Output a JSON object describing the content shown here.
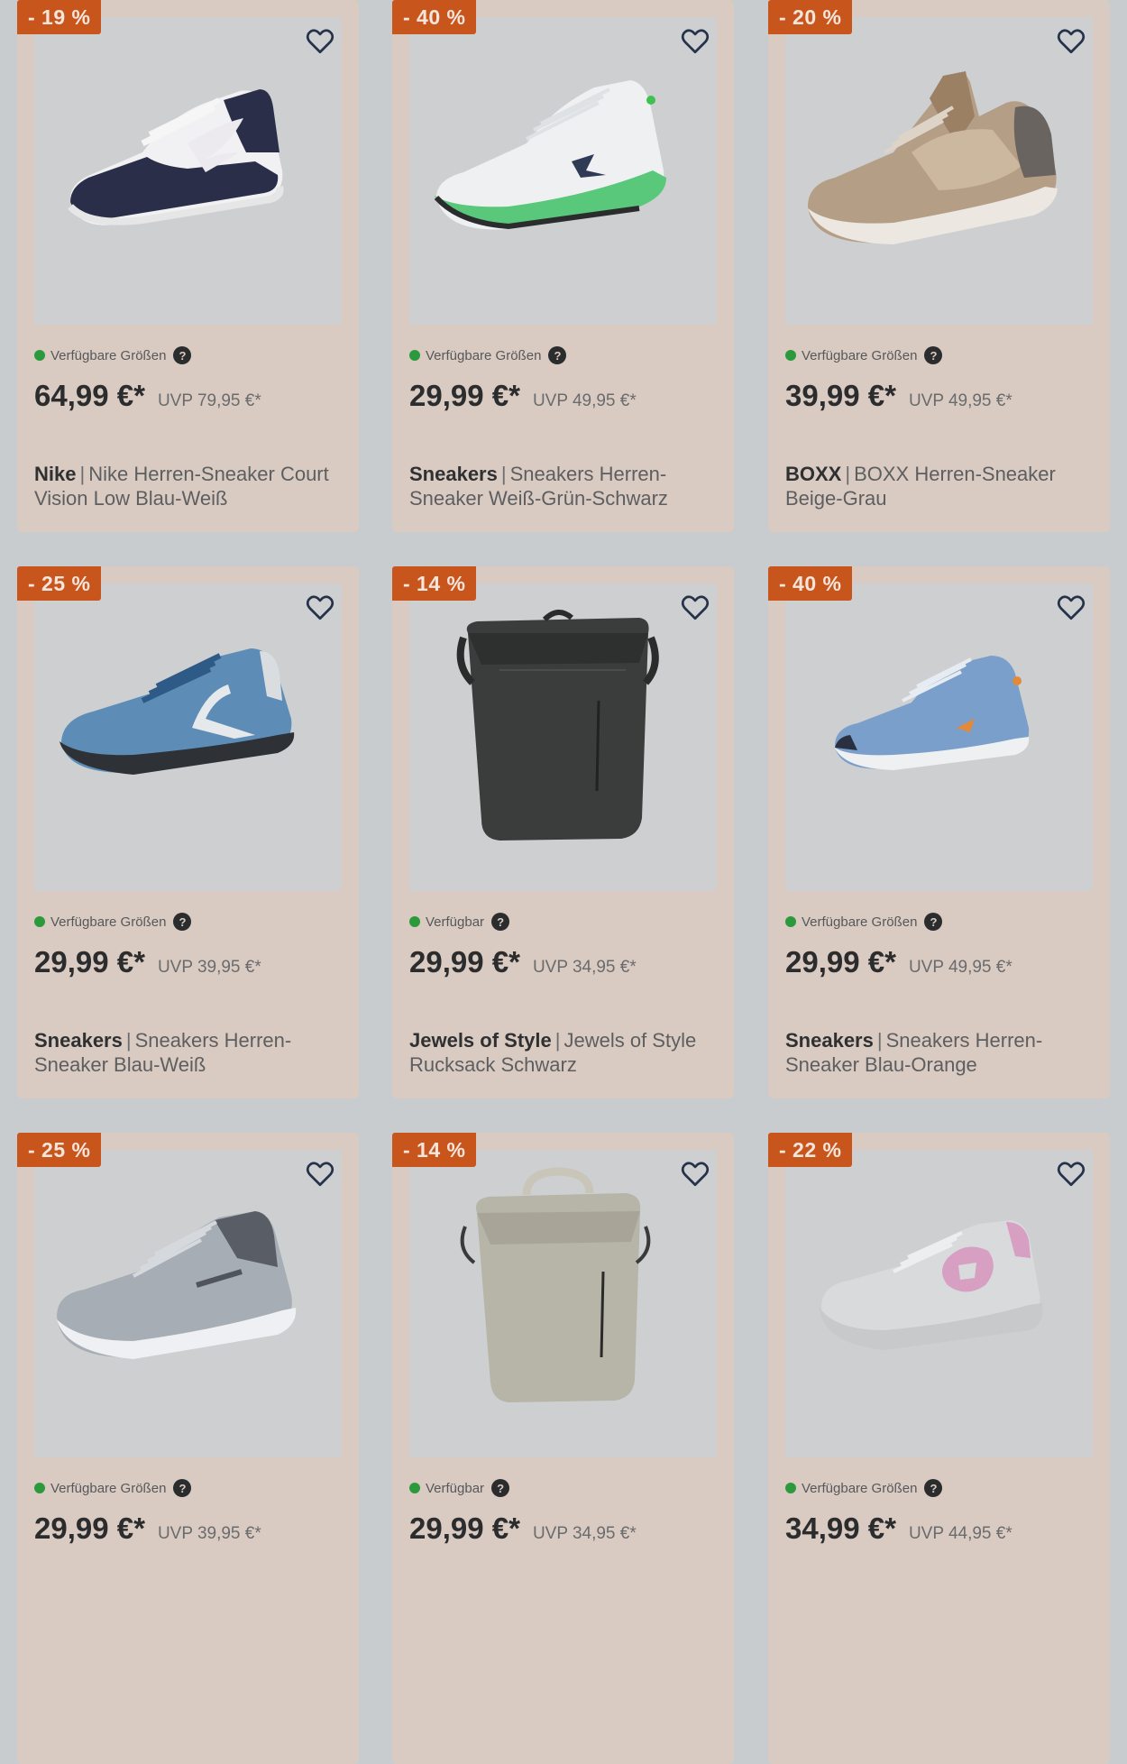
{
  "products": [
    {
      "discount": "- 19 %",
      "availability": "Verfügbare Größen",
      "price": "64,99 €*",
      "uvp": "UVP 79,95 €*",
      "brand": "Nike",
      "name": "Nike Herren-Sneaker Court Vision Low Blau-Weiß",
      "image": "sneaker-navy-white"
    },
    {
      "discount": "- 40 %",
      "availability": "Verfügbare Größen",
      "price": "29,99 €*",
      "uvp": "UVP 49,95 €*",
      "brand": "Sneakers",
      "name": "Sneakers Herren-Sneaker Weiß-Grün-Schwarz",
      "image": "sneaker-white-green"
    },
    {
      "discount": "- 20 %",
      "availability": "Verfügbare Größen",
      "price": "39,99 €*",
      "uvp": "UVP 49,95 €*",
      "brand": "BOXX",
      "name": "BOXX Herren-Sneaker Beige-Grau",
      "image": "sneaker-beige-grey"
    },
    {
      "discount": "- 25 %",
      "availability": "Verfügbare Größen",
      "price": "29,99 €*",
      "uvp": "UVP 39,95 €*",
      "brand": "Sneakers",
      "name": "Sneakers Herren-Sneaker Blau-Weiß",
      "image": "sneaker-blue-white"
    },
    {
      "discount": "- 14 %",
      "availability": "Verfügbar",
      "price": "29,99 €*",
      "uvp": "UVP 34,95 €*",
      "brand": "Jewels of Style",
      "name": "Jewels of Style Rucksack Schwarz",
      "image": "backpack-black"
    },
    {
      "discount": "- 40 %",
      "availability": "Verfügbare Größen",
      "price": "29,99 €*",
      "uvp": "UVP 49,95 €*",
      "brand": "Sneakers",
      "name": "Sneakers Herren-Sneaker Blau-Orange",
      "image": "sneaker-blue-orange"
    },
    {
      "discount": "- 25 %",
      "availability": "Verfügbare Größen",
      "price": "29,99 €*",
      "uvp": "UVP 39,95 €*",
      "brand": "",
      "name": "",
      "image": "sneaker-grey-knit"
    },
    {
      "discount": "- 14 %",
      "availability": "Verfügbar",
      "price": "29,99 €*",
      "uvp": "UVP 34,95 €*",
      "brand": "",
      "name": "",
      "image": "backpack-beige"
    },
    {
      "discount": "- 22 %",
      "availability": "Verfügbare Größen",
      "price": "34,99 €*",
      "uvp": "UVP 44,95 €*",
      "brand": "",
      "name": "",
      "image": "sneaker-grey-pink"
    }
  ],
  "help_icon_glyph": "?",
  "colors": {
    "badge": "#c8561c",
    "card": "#dacbc2",
    "available_dot": "#2c9a3c"
  }
}
